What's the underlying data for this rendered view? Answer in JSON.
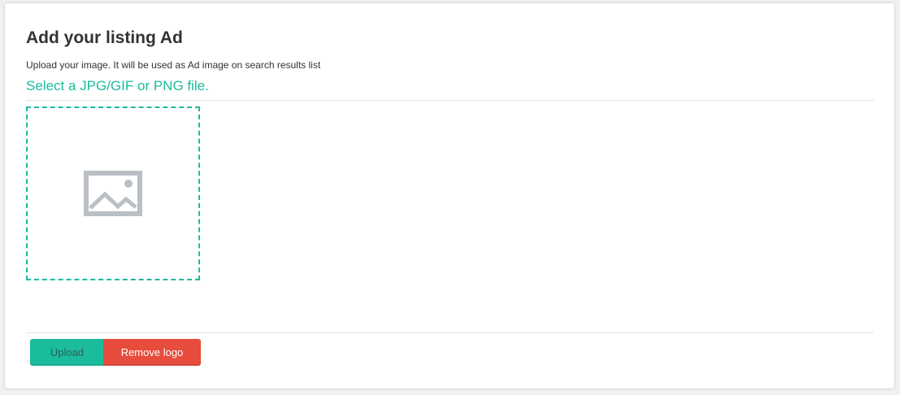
{
  "header": {
    "title": "Add your listing Ad",
    "subtitle": "Upload your image. It will be used as Ad image on search results list",
    "hint": "Select a JPG/GIF or PNG file."
  },
  "dropzone": {
    "icon": "image-placeholder-icon",
    "icon_color": "#b9bfc4",
    "border_color": "#1abc9c"
  },
  "actions": {
    "upload_label": "Upload",
    "remove_label": "Remove logo"
  },
  "colors": {
    "accent": "#1abc9c",
    "danger": "#e74c3c"
  }
}
